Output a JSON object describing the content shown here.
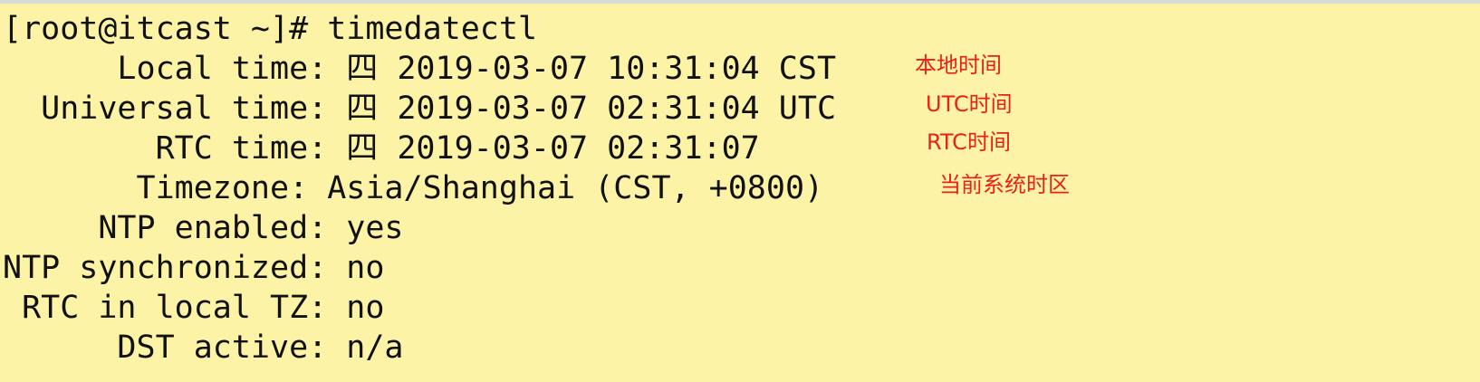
{
  "terminal": {
    "lines": [
      "[root@itcast ~]# timedatectl",
      "      Local time: 四 2019-03-07 10:31:04 CST",
      "  Universal time: 四 2019-03-07 02:31:04 UTC",
      "        RTC time: 四 2019-03-07 02:31:07",
      "       Timezone: Asia/Shanghai (CST, +0800)",
      "     NTP enabled: yes",
      "NTP synchronized: no",
      " RTC in local TZ: no",
      "      DST active: n/a"
    ]
  },
  "annotations": {
    "local_time": "本地时间",
    "utc_time": "UTC时间",
    "rtc_time": "RTC时间",
    "current_timezone": "当前系统时区"
  },
  "colors": {
    "terminal_background": "#fdf3a6",
    "terminal_text": "#111111",
    "annotation_text": "#e8221b"
  }
}
